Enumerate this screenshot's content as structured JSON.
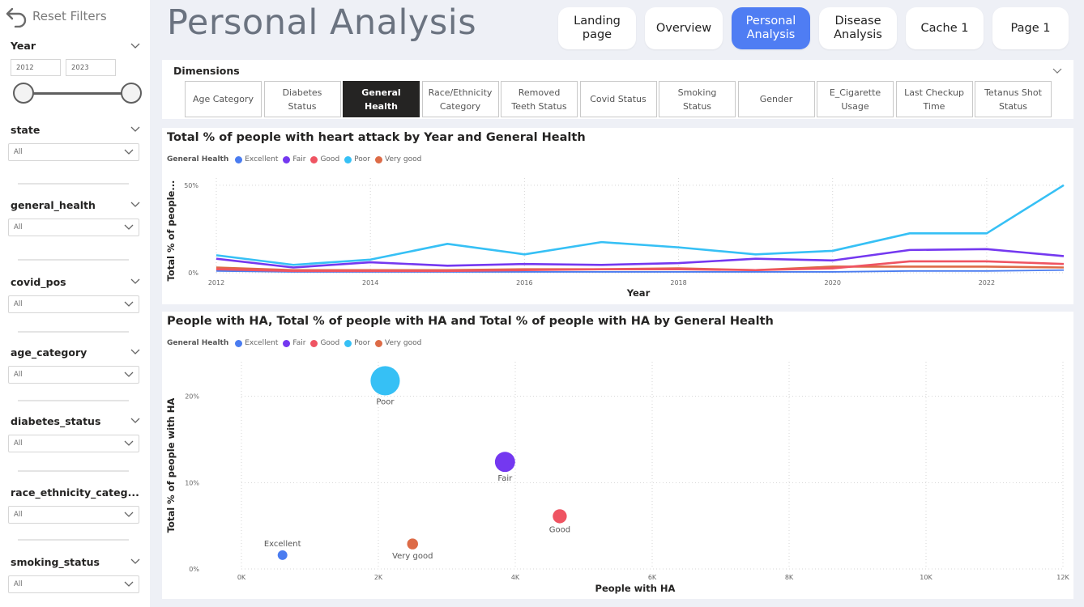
{
  "sidebar": {
    "reset_label": "Reset Filters",
    "year": {
      "title": "Year",
      "start": "2012",
      "end": "2023"
    },
    "slicers": [
      {
        "title": "state",
        "value": "All"
      },
      {
        "title": "general_health",
        "value": "All"
      },
      {
        "title": "covid_pos",
        "value": "All"
      },
      {
        "title": "age_category",
        "value": "All"
      },
      {
        "title": "diabetes_status",
        "value": "All"
      },
      {
        "title": "race_ethnicity_categ...",
        "value": "All"
      },
      {
        "title": "smoking_status",
        "value": "All"
      }
    ]
  },
  "header": {
    "title": "Personal Analysis",
    "nav": [
      {
        "label": "Landing\npage",
        "active": false
      },
      {
        "label": "Overview",
        "active": false
      },
      {
        "label": "Personal\nAnalysis",
        "active": true
      },
      {
        "label": "Disease\nAnalysis",
        "active": false
      },
      {
        "label": "Cache 1",
        "active": false
      },
      {
        "label": "Page 1",
        "active": false
      }
    ]
  },
  "dimensions": {
    "title": "Dimensions",
    "buttons": [
      {
        "label": "Age Category",
        "active": false
      },
      {
        "label": "Diabetes\nStatus",
        "active": false
      },
      {
        "label": "General Health",
        "active": true
      },
      {
        "label": "Race/Ethnicity\nCategory",
        "active": false
      },
      {
        "label": "Removed\nTeeth Status",
        "active": false
      },
      {
        "label": "Covid Status",
        "active": false
      },
      {
        "label": "Smoking\nStatus",
        "active": false
      },
      {
        "label": "Gender",
        "active": false
      },
      {
        "label": "E_Cigarette\nUsage",
        "active": false
      },
      {
        "label": "Last Checkup\nTime",
        "active": false
      },
      {
        "label": "Tetanus Shot\nStatus",
        "active": false
      }
    ]
  },
  "colors": {
    "Excellent": "#4a7cf0",
    "Fair": "#7438f0",
    "Good": "#ef5462",
    "Poor": "#36c0f5",
    "Very good": "#dd6b47",
    "accent": "#4f7df3"
  },
  "chart_data": [
    {
      "type": "line",
      "title": "Total % of people with heart attack by Year and General Health",
      "legend_title": "General Health",
      "xlabel": "Year",
      "ylabel": "Total % of people...",
      "x": [
        2012,
        2013,
        2014,
        2015,
        2016,
        2017,
        2018,
        2019,
        2020,
        2021,
        2022,
        2023
      ],
      "xticks": [
        2012,
        2014,
        2016,
        2018,
        2020,
        2022
      ],
      "yticks": [
        "0%",
        "50%"
      ],
      "ylim": [
        0,
        55
      ],
      "series": [
        {
          "name": "Excellent",
          "values": [
            1,
            0.5,
            0.5,
            0.5,
            0.5,
            0.5,
            0.5,
            0.5,
            0.5,
            1,
            1,
            1.5
          ]
        },
        {
          "name": "Fair",
          "values": [
            8,
            3,
            6,
            4,
            5,
            4.5,
            5.5,
            8,
            7,
            13,
            13.5,
            9.5
          ]
        },
        {
          "name": "Good",
          "values": [
            2,
            1,
            1,
            1,
            1.5,
            2,
            2,
            1.5,
            2.5,
            6.5,
            6.5,
            5
          ]
        },
        {
          "name": "Poor",
          "values": [
            10,
            4.5,
            7.5,
            16.5,
            10.5,
            17.5,
            14.5,
            10.5,
            12.5,
            22.5,
            22.5,
            50
          ]
        },
        {
          "name": "Very good",
          "values": [
            3,
            1.5,
            1.5,
            1.5,
            2,
            2,
            2.5,
            1.5,
            3.5,
            3.5,
            3.5,
            3
          ]
        }
      ],
      "grid": true
    },
    {
      "type": "scatter",
      "title": "People with HA, Total % of people with HA and Total % of people with HA by General Health",
      "legend_title": "General Health",
      "xlabel": "People with HA",
      "ylabel": "Total % of people with HA",
      "xlim": [
        0,
        12000
      ],
      "ylim": [
        0,
        24
      ],
      "xticks": [
        "0K",
        "2K",
        "4K",
        "6K",
        "8K",
        "10K",
        "12K"
      ],
      "yticks": [
        "0%",
        "10%",
        "20%"
      ],
      "points": [
        {
          "name": "Poor",
          "x": 2100,
          "y": 21.8
        },
        {
          "name": "Fair",
          "x": 3850,
          "y": 12.4
        },
        {
          "name": "Good",
          "x": 4650,
          "y": 6.1
        },
        {
          "name": "Very good",
          "x": 2500,
          "y": 2.9
        },
        {
          "name": "Excellent",
          "x": 600,
          "y": 1.6
        }
      ],
      "size_by": "Total % of people with HA",
      "grid": true
    }
  ]
}
